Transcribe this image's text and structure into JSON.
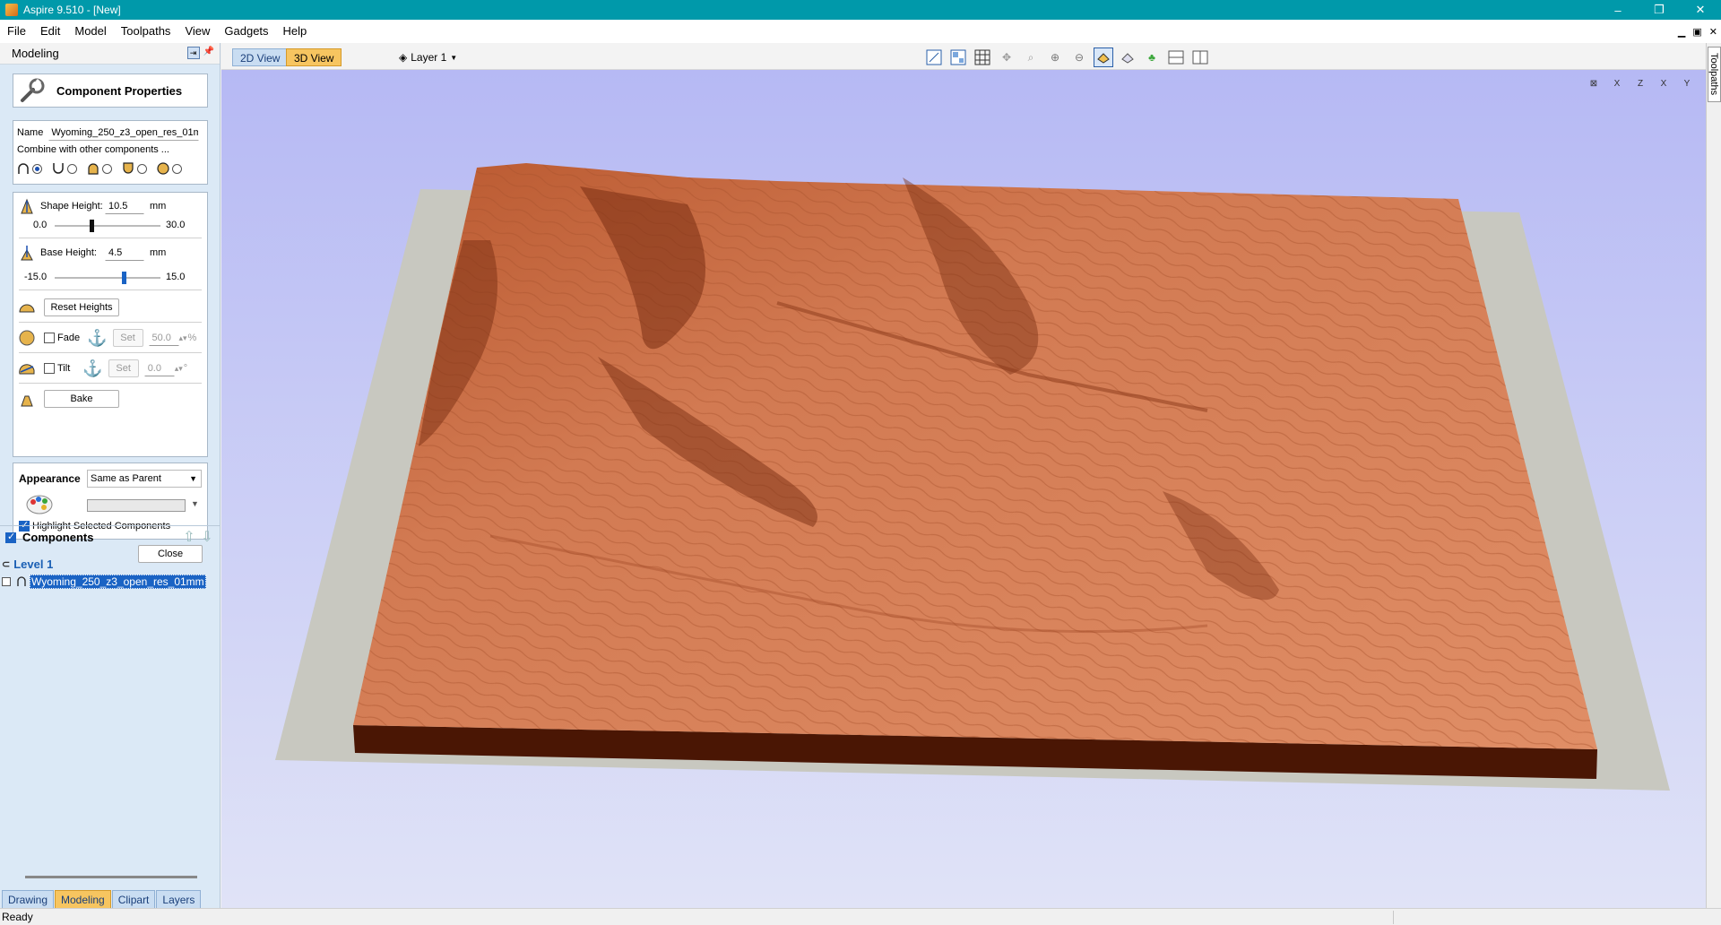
{
  "window": {
    "title": "Aspire 9.510 - [New]",
    "controls": [
      "–",
      "❐",
      "✕"
    ]
  },
  "menu": {
    "items": [
      "File",
      "Edit",
      "Model",
      "Toolpaths",
      "View",
      "Gadgets",
      "Help"
    ],
    "mdi_controls": [
      "▁",
      "▣",
      "✕"
    ]
  },
  "panel": {
    "title": "Modeling"
  },
  "component_properties": {
    "title": "Component Properties",
    "name_label": "Name",
    "name_value": "Wyoming_250_z3_open_res_01mm",
    "combine_label": "Combine with other components ...",
    "shape_height_label": "Shape Height:",
    "shape_height_value": "10.5",
    "shape_height_unit": "mm",
    "shape_height_min": "0.0",
    "shape_height_max": "30.0",
    "shape_height_fraction": 0.35,
    "base_height_label": "Base Height:",
    "base_height_value": "4.5",
    "base_height_unit": "mm",
    "base_height_min": "-15.0",
    "base_height_max": "15.0",
    "base_height_fraction": 0.65,
    "reset_heights_label": "Reset Heights",
    "fade_label": "Fade",
    "fade_set_label": "Set",
    "fade_value": "50.0",
    "fade_unit": "%",
    "tilt_label": "Tilt",
    "tilt_set_label": "Set",
    "tilt_value": "0.0",
    "tilt_unit": "°",
    "bake_label": "Bake",
    "appearance_label": "Appearance",
    "appearance_value": "Same as Parent",
    "highlight_label": "Highlight Selected Components",
    "close_label": "Close"
  },
  "components": {
    "title": "Components",
    "level_label": "Level 1",
    "item_label": "Wyoming_250_z3_open_res_01mm"
  },
  "bottom_tabs": [
    "Drawing",
    "Modeling",
    "Clipart",
    "Layers"
  ],
  "view": {
    "tab_2d": "2D View",
    "tab_3d": "3D View",
    "layer_label": "Layer 1",
    "axis_buttons": [
      "⊠",
      "X",
      "Z",
      "X",
      "Y"
    ]
  },
  "right_strip": {
    "label": "Toolpaths"
  },
  "status": {
    "text": "Ready"
  },
  "colors": {
    "titlebar": "#0099aa",
    "panel_bg": "#dbe9f6",
    "active_tab": "#f7c560",
    "terrain": "#d27a52",
    "terrain_side": "#4a1604",
    "plate": "#c8c8c0"
  }
}
